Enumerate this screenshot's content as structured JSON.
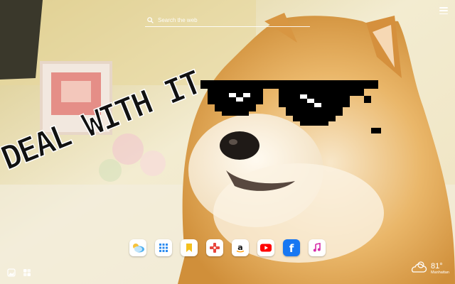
{
  "search": {
    "placeholder": "Search the web"
  },
  "meme": {
    "caption": "DEAL WITH IT"
  },
  "dock": [
    {
      "icon": "weather-icon",
      "label": "Weather"
    },
    {
      "icon": "apps-grid-icon",
      "label": "Apps"
    },
    {
      "icon": "bookmark-icon",
      "label": "Bookmarks"
    },
    {
      "icon": "games-icon",
      "label": "Games"
    },
    {
      "icon": "amazon-icon",
      "label": "Amazon"
    },
    {
      "icon": "youtube-icon",
      "label": "YouTube"
    },
    {
      "icon": "facebook-icon",
      "label": "Facebook"
    },
    {
      "icon": "music-icon",
      "label": "Music"
    }
  ],
  "weather": {
    "temp": "81°",
    "location": "Manhattan"
  },
  "colors": {
    "accent": "#ffffff",
    "youtube": "#ff0000",
    "facebook": "#1877f2",
    "bookmark": "#f4c01e"
  }
}
